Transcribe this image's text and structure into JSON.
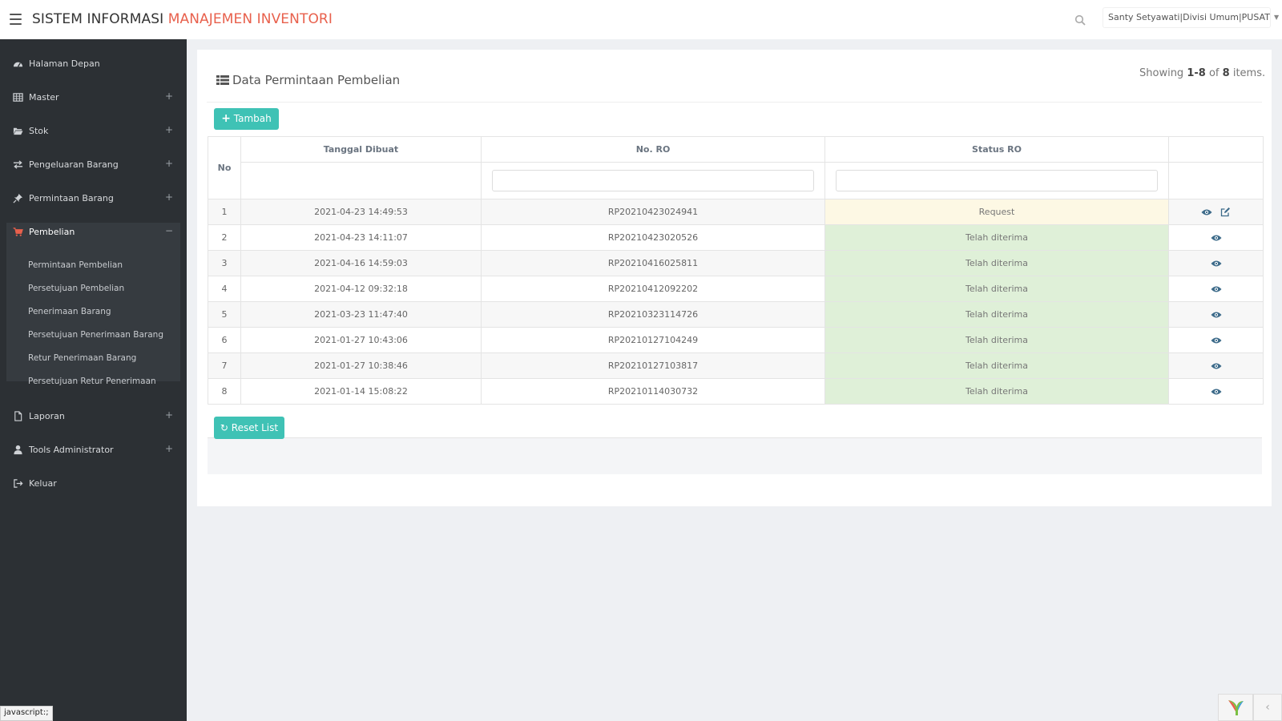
{
  "header": {
    "title_main": "SISTEM INFORMASI",
    "title_accent": "MANAJEMEN INVENTORI",
    "user": "Santy Setyawati|Divisi Umum|PUSAT",
    "accent_color": "#e8604c"
  },
  "sidebar": {
    "items": [
      {
        "label": "Halaman Depan",
        "icon": "dashboard-icon"
      },
      {
        "label": "Master",
        "icon": "table-icon",
        "expand": "+"
      },
      {
        "label": "Stok",
        "icon": "folder-open-icon",
        "expand": "+"
      },
      {
        "label": "Pengeluaran Barang",
        "icon": "exchange-icon",
        "expand": "+"
      },
      {
        "label": "Permintaan Barang",
        "icon": "thumbtack-icon",
        "expand": "+"
      },
      {
        "label": "Pembelian",
        "icon": "shopping-cart-icon",
        "expand": "−",
        "active": true
      },
      {
        "label": "Laporan",
        "icon": "file-icon",
        "expand": "+"
      },
      {
        "label": "Tools Administrator",
        "icon": "user-icon",
        "expand": "+"
      },
      {
        "label": "Keluar",
        "icon": "sign-out-icon"
      }
    ],
    "submenu": [
      "Permintaan Pembelian",
      "Persetujuan Pembelian",
      "Penerimaan Barang",
      "Persetujuan Penerimaan Barang",
      "Retur Penerimaan Barang",
      "Persetujuan Retur Penerimaan"
    ]
  },
  "panel": {
    "title": "Data Permintaan Pembelian",
    "summary_prefix": "Showing",
    "summary_range": "1-8",
    "summary_of": "of",
    "summary_total": "8",
    "summary_suffix": "items.",
    "add_button": "Tambah",
    "reset_button": "Reset List"
  },
  "table": {
    "headers": {
      "no": "No",
      "date": "Tanggal Dibuat",
      "ro": "No. RO",
      "status": "Status RO"
    },
    "rows": [
      {
        "no": "1",
        "date": "2021-04-23 14:49:53",
        "ro": "RP20210423024941",
        "status": "Request",
        "editable": true
      },
      {
        "no": "2",
        "date": "2021-04-23 14:11:07",
        "ro": "RP20210423020526",
        "status": "Telah diterima",
        "editable": false
      },
      {
        "no": "3",
        "date": "2021-04-16 14:59:03",
        "ro": "RP20210416025811",
        "status": "Telah diterima",
        "editable": false
      },
      {
        "no": "4",
        "date": "2021-04-12 09:32:18",
        "ro": "RP20210412092202",
        "status": "Telah diterima",
        "editable": false
      },
      {
        "no": "5",
        "date": "2021-03-23 11:47:40",
        "ro": "RP20210323114726",
        "status": "Telah diterima",
        "editable": false
      },
      {
        "no": "6",
        "date": "2021-01-27 10:43:06",
        "ro": "RP20210127104249",
        "status": "Telah diterima",
        "editable": false
      },
      {
        "no": "7",
        "date": "2021-01-27 10:38:46",
        "ro": "RP20210127103817",
        "status": "Telah diterima",
        "editable": false
      },
      {
        "no": "8",
        "date": "2021-01-14 15:08:22",
        "ro": "RP20210114030732",
        "status": "Telah diterima",
        "editable": false
      }
    ]
  },
  "statusbar": {
    "text": "javascript:;"
  }
}
